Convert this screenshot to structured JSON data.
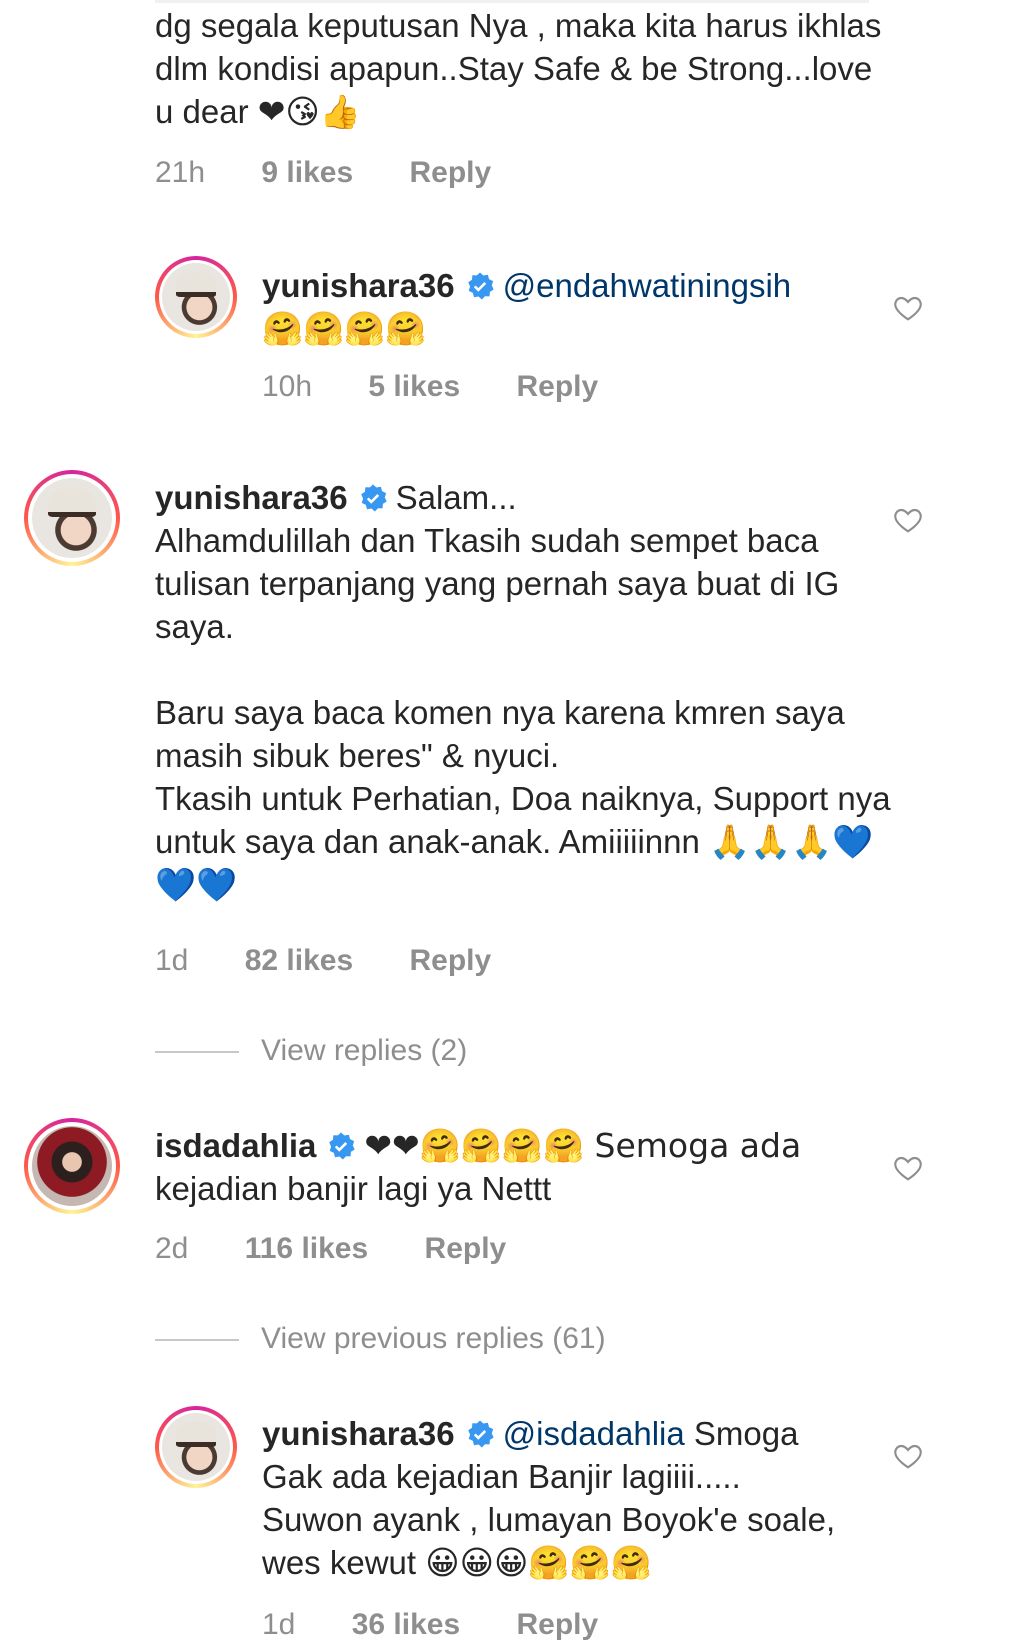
{
  "comment_prev": {
    "lines": "dg segala keputusan Nya , maka kita harus ikhlas dlm kondisi apapun..Stay Safe & be Strong...love u dear ❤😘👍",
    "time": "21h",
    "likes": "9 likes",
    "reply": "Reply"
  },
  "reply_1": {
    "username": "yunishara36",
    "mention": "@endahwatiningsih",
    "text": "🤗🤗🤗🤗",
    "time": "10h",
    "likes": "5 likes",
    "reply": "Reply"
  },
  "comment_main": {
    "username": "yunishara36",
    "text_first": "Salam...",
    "body": "Alhamdulillah dan Tkasih sudah sempet baca tulisan terpanjang yang pernah saya buat di IG saya.\n\nBaru saya baca komen nya karena kmren saya masih sibuk beres\" & nyuci.\nTkasih untuk Perhatian, Doa naiknya, Support nya untuk saya dan anak-anak. Amiiiiinnn 🙏🙏🙏💙💙💙",
    "time": "1d",
    "likes": "82 likes",
    "reply": "Reply",
    "view_replies": "View replies (2)"
  },
  "comment_isda": {
    "username": "isdadahlia",
    "text_first": "❤❤🤗🤗🤗🤗 Semoga ada",
    "body": "kejadian banjir lagi ya Nettt",
    "time": "2d",
    "likes": "116 likes",
    "reply": "Reply",
    "view_replies": "View previous replies (61)"
  },
  "reply_2": {
    "username": "yunishara36",
    "mention": "@isdadahlia",
    "text_first": "Smoga",
    "body": "Gak ada kejadian Banjir lagiiii.....\nSuwon ayank , lumayan Boyok'e soale, wes kewut 😀😀😀🤗🤗🤗",
    "time": "1d",
    "likes": "36 likes",
    "reply": "Reply"
  },
  "colors": {
    "text": "#262626",
    "meta": "#8e8e8e",
    "verified": "#3897f0"
  }
}
